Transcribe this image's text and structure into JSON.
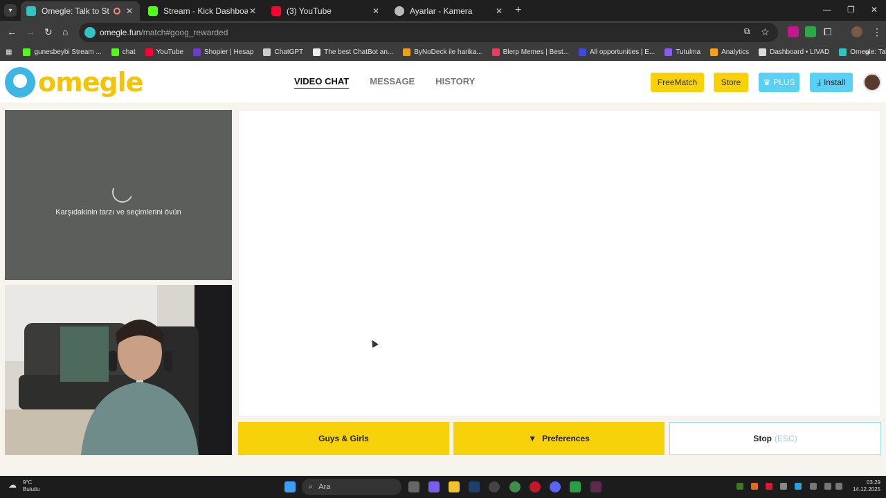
{
  "browser": {
    "tabs": [
      {
        "title": "Omegle: Talk to Strangers w",
        "favicon_color": "#35c2c2",
        "active": true,
        "recording": true
      },
      {
        "title": "Stream - Kick Dashboard",
        "favicon_color": "#53fc18",
        "active": false
      },
      {
        "title": "(3) YouTube",
        "favicon_color": "#ff0033",
        "active": false
      },
      {
        "title": "Ayarlar - Kamera",
        "favicon_color": "#bbbbbb",
        "active": false
      }
    ],
    "url_host": "omegle.fun",
    "url_path": "/match#goog_rewarded",
    "bookmarks": [
      {
        "label": "gunesbeybi Stream ...",
        "color": "#53fc18"
      },
      {
        "label": "chat",
        "color": "#53fc18"
      },
      {
        "label": "YouTube",
        "color": "#ff0033"
      },
      {
        "label": "Shopier | Hesap",
        "color": "#6c3bd1"
      },
      {
        "label": "ChatGPT",
        "color": "#cccccc"
      },
      {
        "label": "The best ChatBot an...",
        "color": "#eeeeee"
      },
      {
        "label": "ByNoDeck ile harika...",
        "color": "#e6a21c"
      },
      {
        "label": "Blerp Memes | Best...",
        "color": "#e83d5c"
      },
      {
        "label": "All opportunities | E...",
        "color": "#3b4cd8"
      },
      {
        "label": "Tutulma",
        "color": "#8a5cf0"
      },
      {
        "label": "Analytics",
        "color": "#f4a11d"
      },
      {
        "label": "Dashboard • LIVAD",
        "color": "#dddddd"
      },
      {
        "label": "Omegle: Talk to Stra...",
        "color": "#35c2c2"
      }
    ]
  },
  "site": {
    "logo": "omegle",
    "nav": {
      "video_chat": "VIDEO CHAT",
      "message": "MESSAGE",
      "history": "HISTORY"
    },
    "buttons": {
      "freematch": "FreeMatch",
      "store": "Store",
      "plus": "PLUS",
      "install": "Install"
    },
    "remote_status": "Karşıdakinin tarzı ve seçimlerini övün",
    "actions": {
      "gender": "Guys & Girls",
      "preferences": "Preferences",
      "stop": "Stop",
      "stop_hint": "(ESC)"
    }
  },
  "taskbar": {
    "weather_temp": "9°C",
    "weather_desc": "Bulutlu",
    "search_placeholder": "Ara",
    "time": "03:29",
    "date": "14.12.2025"
  },
  "colors": {
    "brand_yellow": "#f7d10a",
    "brand_blue": "#3cb7e4",
    "plus_blue": "#5bd0f5"
  }
}
